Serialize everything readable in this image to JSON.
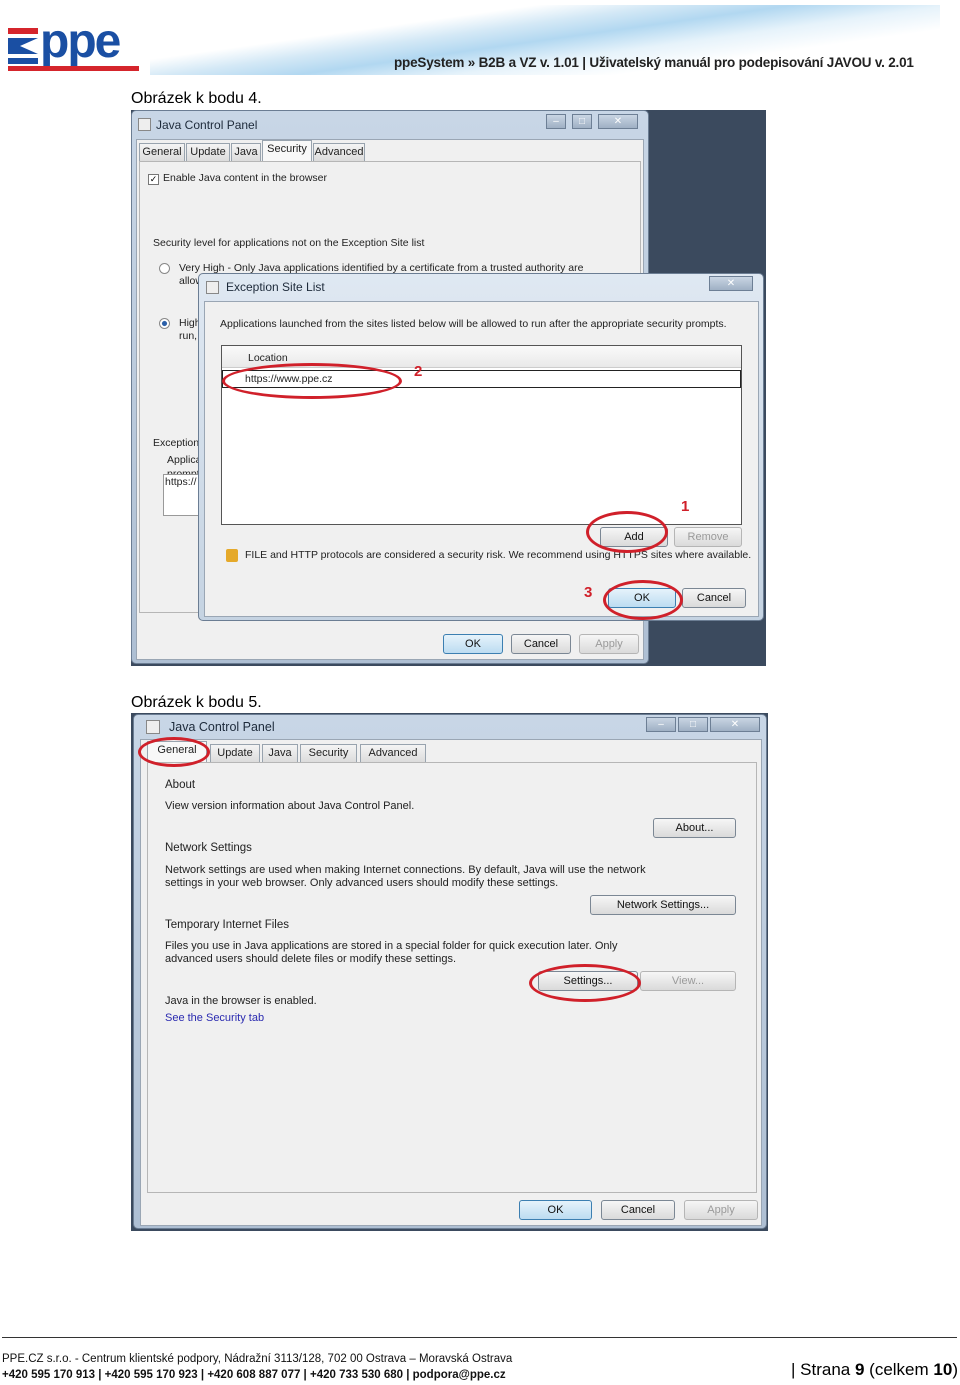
{
  "header": {
    "logo": "ppe",
    "doc_title": "ppeSystem » B2B a VZ v. 1.01 |  Uživatelský manuál pro podepisování JAVOU v. 2.01"
  },
  "figure4": {
    "caption": "Obrázek k bodu 4.",
    "window_title": "Java Control Panel",
    "tabs": [
      "General",
      "Update",
      "Java",
      "Security",
      "Advanced"
    ],
    "active_tab": "Security",
    "enable_java": "Enable Java content in the browser",
    "security_level_label": "Security level for applications not on the Exception Site list",
    "very_high": "Very High - Only Java applications identified by a certificate from a trusted authority are",
    "very_high_cont": "allow",
    "high": "High",
    "high_cont": "run,",
    "exception": "Exception",
    "applica": "Applica",
    "prompt": "prompt",
    "https_partial": "https://",
    "buttons": {
      "ok": "OK",
      "cancel": "Cancel",
      "apply": "Apply"
    },
    "dialog": {
      "title": "Exception Site List",
      "description": "Applications launched from the sites listed below will be allowed to run after the appropriate security prompts.",
      "column": "Location",
      "rows": [
        "https://www.ppe.cz"
      ],
      "add": "Add",
      "remove": "Remove",
      "warning": "FILE and HTTP protocols are considered a security risk.  We recommend using HTTPS sites where available.",
      "ok": "OK",
      "cancel": "Cancel"
    },
    "markers": [
      "1",
      "2",
      "3"
    ],
    "marker_color": "#d0202a"
  },
  "figure5": {
    "caption": "Obrázek k bodu 5.",
    "window_title": "Java Control Panel",
    "tabs": [
      "General",
      "Update",
      "Java",
      "Security",
      "Advanced"
    ],
    "active_tab": "General",
    "about_heading": "About",
    "about_text": "View version information about Java Control Panel.",
    "about_btn": "About...",
    "network_heading": "Network Settings",
    "network_text1": "Network settings are used when making Internet connections. By default, Java will use the network",
    "network_text2": "settings in your web browser. Only advanced users should modify these settings.",
    "network_btn": "Network Settings...",
    "temp_heading": "Temporary Internet Files",
    "temp_text1": "Files you use in Java applications are stored in a special folder for quick execution later. Only",
    "temp_text2": "advanced users should delete files or modify these settings.",
    "settings_btn": "Settings...",
    "view_btn": "View...",
    "browser_status": "Java in the browser is enabled.",
    "security_link": "See the Security tab",
    "buttons": {
      "ok": "OK",
      "cancel": "Cancel",
      "apply": "Apply"
    }
  },
  "footer": {
    "line1": "PPE.CZ s.r.o. - Centrum klientské podpory, Nádražní 3113/128, 702 00  Ostrava – Moravská Ostrava",
    "line2": "+420 595 170 913 |  +420 595 170 923 |  +420 608 887 077 |  +420 733 530 680 |  podpora@ppe.cz",
    "page_prefix": "|  Strana ",
    "page": "9",
    "total_prefix": " (celkem ",
    "total": "10",
    "total_suffix": ")"
  }
}
